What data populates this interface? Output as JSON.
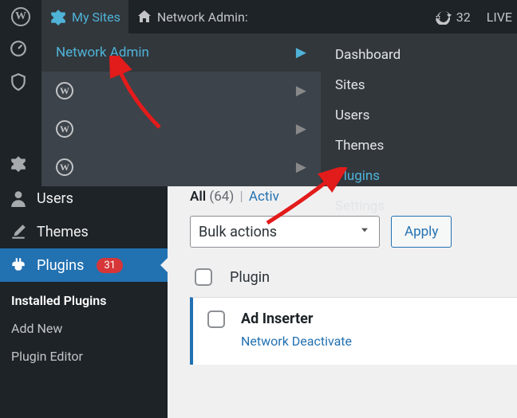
{
  "adminbar": {
    "my_sites_label": "My Sites",
    "context_label": "Network Admin:",
    "updates_count": "32",
    "live_label": "LIVE"
  },
  "flyout": {
    "primary": {
      "network_admin": "Network Admin"
    },
    "submenu": [
      "Dashboard",
      "Sites",
      "Users",
      "Themes",
      "Plugins",
      "Settings"
    ],
    "submenu_active_index": 4
  },
  "leftmenu": {
    "users": "Users",
    "themes": "Themes",
    "plugins": "Plugins",
    "plugins_badge": "31",
    "submenu": {
      "installed": "Installed Plugins",
      "add_new": "Add New",
      "plugin_editor": "Plugin Editor"
    }
  },
  "filters": {
    "all_label": "All",
    "all_count": "(64)",
    "active_label": "Activ"
  },
  "bulk": {
    "select_label": "Bulk actions",
    "apply_label": "Apply"
  },
  "table": {
    "col_plugin": "Plugin",
    "row1": {
      "name": "Ad Inserter",
      "action": "Network Deactivate"
    }
  }
}
